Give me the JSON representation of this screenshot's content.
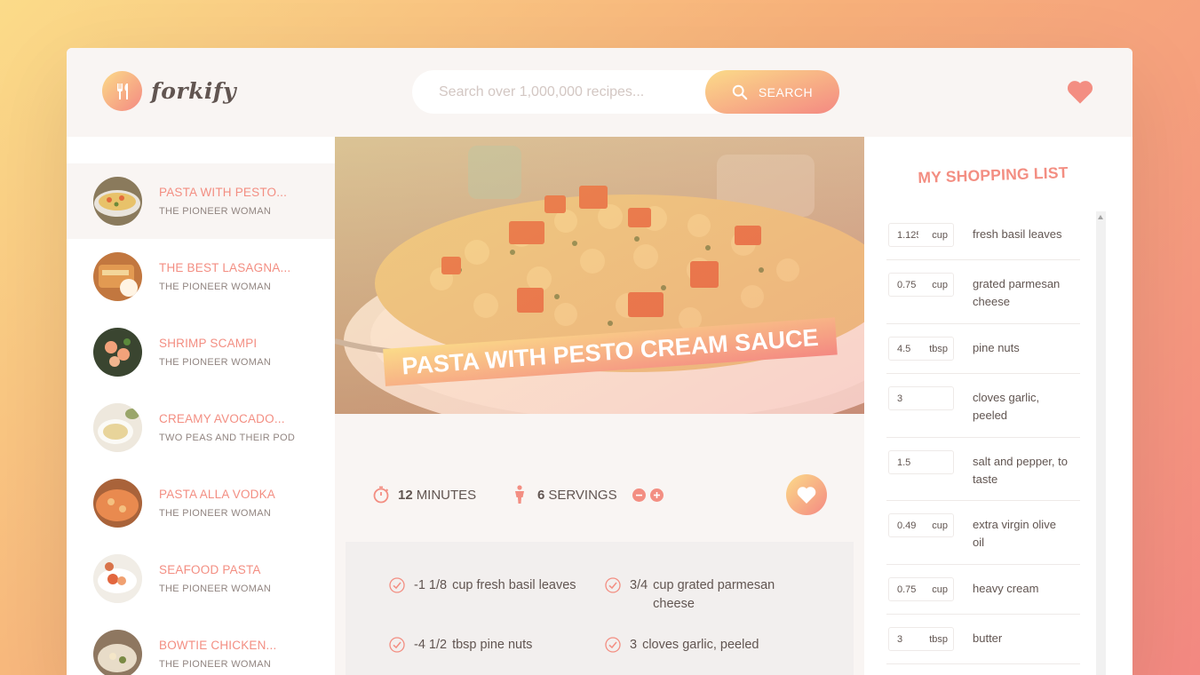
{
  "app": {
    "name": "forkify"
  },
  "search": {
    "placeholder": "Search over 1,000,000 recipes...",
    "button_label": "SEARCH"
  },
  "results": [
    {
      "title": "PASTA WITH PESTO...",
      "publisher": "THE PIONEER WOMAN",
      "active": true
    },
    {
      "title": "THE BEST LASAGNA...",
      "publisher": "THE PIONEER WOMAN",
      "active": false
    },
    {
      "title": "SHRIMP SCAMPI",
      "publisher": "THE PIONEER WOMAN",
      "active": false
    },
    {
      "title": "CREAMY AVOCADO...",
      "publisher": "TWO PEAS AND THEIR POD",
      "active": false
    },
    {
      "title": "PASTA ALLA VODKA",
      "publisher": "THE PIONEER WOMAN",
      "active": false
    },
    {
      "title": "SEAFOOD PASTA",
      "publisher": "THE PIONEER WOMAN",
      "active": false
    },
    {
      "title": "BOWTIE CHICKEN...",
      "publisher": "THE PIONEER WOMAN",
      "active": false
    }
  ],
  "recipe": {
    "title": "PASTA WITH PESTO CREAM SAUCE",
    "minutes": "12",
    "minutes_unit": "MINUTES",
    "servings": "6",
    "servings_unit": "SERVINGS",
    "ingredients": [
      {
        "qty": "-1 1/8",
        "text": "cup fresh basil leaves"
      },
      {
        "qty": "3/4",
        "text": "cup grated parmesan cheese"
      },
      {
        "qty": "-4 1/2",
        "text": "tbsp pine nuts"
      },
      {
        "qty": "3",
        "text": "cloves garlic, peeled"
      }
    ]
  },
  "shopping": {
    "title": "MY SHOPPING LIST",
    "items": [
      {
        "count": "1.125",
        "unit": "cup",
        "desc": "fresh basil leaves"
      },
      {
        "count": "0.75",
        "unit": "cup",
        "desc": "grated parmesan cheese"
      },
      {
        "count": "4.5",
        "unit": "tbsp",
        "desc": "pine nuts"
      },
      {
        "count": "3",
        "unit": "",
        "desc": "cloves garlic, peeled"
      },
      {
        "count": "1.5",
        "unit": "",
        "desc": "salt and pepper, to taste"
      },
      {
        "count": "0.49",
        "unit": "cup",
        "desc": "extra virgin olive oil"
      },
      {
        "count": "0.75",
        "unit": "cup",
        "desc": "heavy cream"
      },
      {
        "count": "3",
        "unit": "tbsp",
        "desc": "butter"
      }
    ]
  },
  "colors": {
    "accent": "#f38e82",
    "grad_start": "#fbdb89",
    "grad_end": "#f48982",
    "text": "#615551",
    "panel": "#f9f5f3"
  },
  "icons": {
    "search": "search-icon",
    "likes": "heart-icon",
    "timer": "stopwatch-icon",
    "servings": "person-icon",
    "check": "check-circle-icon"
  }
}
